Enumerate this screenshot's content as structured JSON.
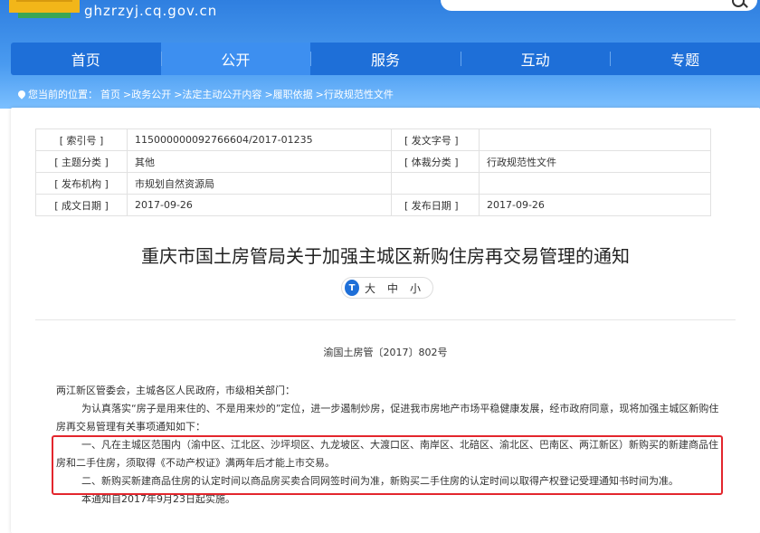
{
  "header": {
    "site_url": "ghzrzyj.cq.gov.cn"
  },
  "nav": {
    "items": [
      "首页",
      "公开",
      "服务",
      "互动",
      "专题"
    ],
    "active_index": 1
  },
  "breadcrumb": {
    "prefix": "您当前的位置：",
    "items": [
      "首页",
      ">政务公开",
      ">法定主动公开内容",
      ">履职依据",
      ">行政规范性文件"
    ]
  },
  "meta": {
    "index_label": "[ 索引号 ]",
    "index_value": "115000000092766604/2017-01235",
    "doc_no_label": "[ 发文字号 ]",
    "doc_no_value": "",
    "topic_label": "[ 主题分类 ]",
    "topic_value": "其他",
    "genre_label": "[ 体裁分类 ]",
    "genre_value": "行政规范性文件",
    "issuer_label": "[ 发布机构 ]",
    "issuer_value": "市规划自然资源局",
    "created_label": "[ 成文日期 ]",
    "created_value": "2017-09-26",
    "published_label": "[ 发布日期 ]",
    "published_value": "2017-09-26"
  },
  "article": {
    "title": "重庆市国土房管局关于加强主城区新购住房再交易管理的通知",
    "font_size": {
      "icon": "T",
      "large": "大",
      "medium": "中",
      "small": "小"
    },
    "doc_number": "渝国土房管〔2017〕802号",
    "salutation": "两江新区管委会，主城各区人民政府，市级相关部门：",
    "intro": "为认真落实“房子是用来住的、不是用来炒的”定位，进一步遏制炒房，促进我市房地产市场平稳健康发展，经市政府同意，现将加强主城区新购住房再交易管理有关事项通知如下：",
    "item1": "一、凡在主城区范围内（渝中区、江北区、沙坪坝区、九龙坡区、大渡口区、南岸区、北碚区、渝北区、巴南区、两江新区）新购买的新建商品住房和二手住房，须取得《不动产权证》满两年后才能上市交易。",
    "item2": "二、新购买新建商品住房的认定时间以商品房买卖合同网签时间为准，新购买二手住房的认定时间以取得产权登记受理通知书时间为准。",
    "effective": "本通知自2017年9月23日起实施。"
  }
}
